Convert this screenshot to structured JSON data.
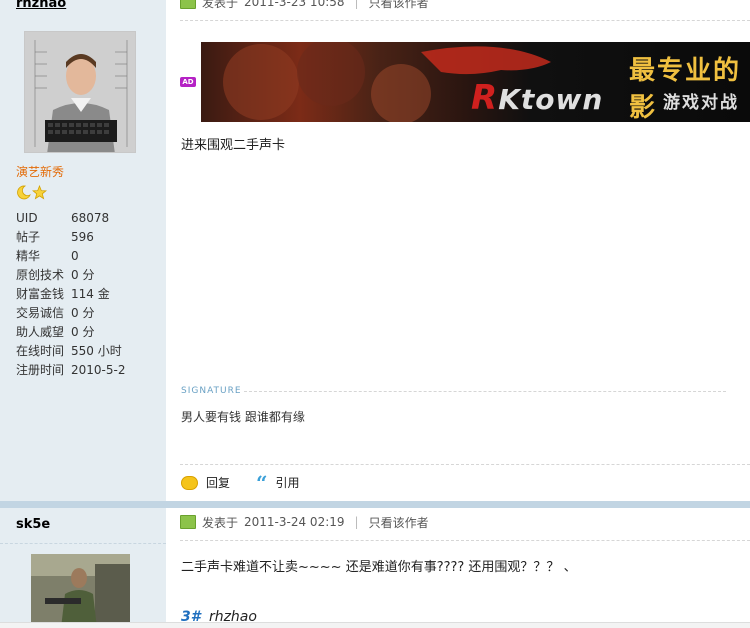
{
  "post1": {
    "author": {
      "username": "rhzhao",
      "rank": "演艺新秀"
    },
    "stats": [
      {
        "label": "UID",
        "value": "68078"
      },
      {
        "label": "帖子",
        "value": "596"
      },
      {
        "label": "精华",
        "value": "0"
      },
      {
        "label": "原创技术",
        "value": "0 分"
      },
      {
        "label": "财富金钱",
        "value": "114 金"
      },
      {
        "label": "交易诚信",
        "value": "0 分"
      },
      {
        "label": "助人威望",
        "value": "0 分"
      },
      {
        "label": "在线时间",
        "value": "550 小时"
      },
      {
        "label": "注册时间",
        "value": "2010-5-2"
      }
    ],
    "meta": {
      "posted_prefix": "发表于",
      "timestamp": "2011-3-23 10:58",
      "author_only": "只看该作者"
    },
    "ad_badge": "AD",
    "banner": {
      "headline": "最专业的影",
      "logo": "Ktown",
      "logo_r": "R",
      "tagline": "游戏对战"
    },
    "content": "进来围观二手声卡",
    "signature_label": "SIGNATURE",
    "signature": "男人要有钱  跟谁都有缘",
    "actions": {
      "reply": "回复",
      "quote": "引用"
    }
  },
  "post2": {
    "author": {
      "username": "sk5e"
    },
    "meta": {
      "posted_prefix": "发表于",
      "timestamp": "2011-3-24 02:19",
      "author_only": "只看该作者"
    },
    "content": "二手声卡难道不让卖~~~~ 还是难道你有事???? 还用围观？？？ 、",
    "quote_floor": "3#",
    "quote_user": "rhzhao"
  },
  "colors": {
    "sidebar_bg": "#E5EDF2",
    "divider": "#C2D5E3",
    "rank": "#e36c09",
    "link_blue": "#1f6fbf"
  }
}
